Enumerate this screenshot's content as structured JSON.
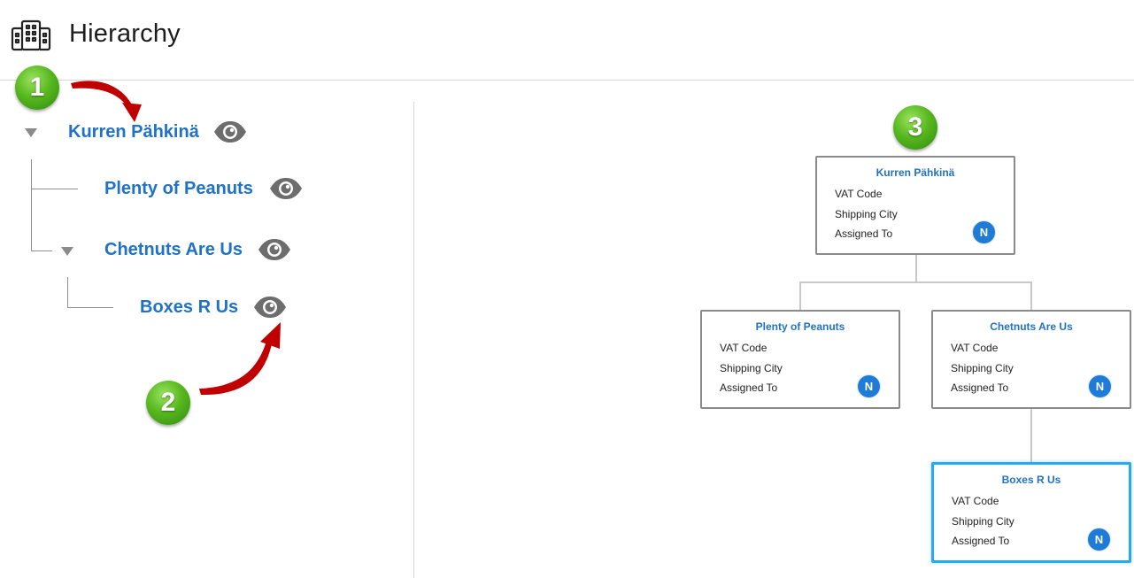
{
  "header": {
    "title": "Hierarchy",
    "icon": "buildings-icon"
  },
  "tree": {
    "root": {
      "label": "Kurren Pähkinä"
    },
    "child1": {
      "label": "Plenty of Peanuts"
    },
    "child2": {
      "label": "Chetnuts Are Us"
    },
    "grandchild": {
      "label": "Boxes R Us"
    }
  },
  "callouts": {
    "one": "1",
    "two": "2",
    "three": "3"
  },
  "org_chart": {
    "fields": {
      "vat": "VAT Code",
      "city": "Shipping City",
      "assigned": "Assigned To"
    },
    "nodes": {
      "root": {
        "title": "Kurren Pähkinä",
        "avatar": "N"
      },
      "peanuts": {
        "title": "Plenty of Peanuts",
        "avatar": "N"
      },
      "chetnuts": {
        "title": "Chetnuts Are Us",
        "avatar": "N"
      },
      "boxes": {
        "title": "Boxes R Us",
        "avatar": "N"
      }
    }
  },
  "colors": {
    "link": "#1f72c6",
    "selected_border": "#27aaf0",
    "avatar": "#1f7cd6",
    "badge": "#4caf18",
    "arrow": "#c00000"
  }
}
